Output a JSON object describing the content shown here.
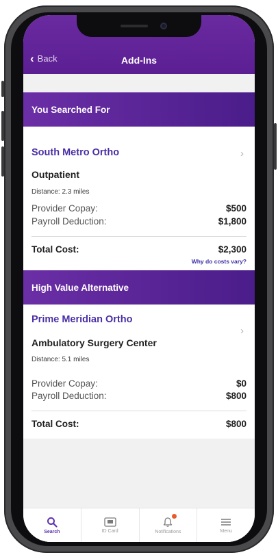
{
  "header": {
    "back_label": "Back",
    "title": "Add-Ins"
  },
  "searched": {
    "section_title": "You Searched For",
    "provider_name": "South Metro Ortho",
    "facility_type": "Outpatient",
    "distance": "Distance: 2.3 miles",
    "copay_label": "Provider Copay:",
    "copay_value": "$500",
    "payroll_label": "Payroll Deduction:",
    "payroll_value": "$1,800",
    "total_label": "Total Cost:",
    "total_value": "$2,300",
    "why_link": "Why do costs vary?"
  },
  "alternative": {
    "section_title": "High Value Alternative",
    "provider_name": "Prime Meridian Ortho",
    "facility_type": "Ambulatory Surgery Center",
    "distance": "Distance: 5.1 miles",
    "copay_label": "Provider Copay:",
    "copay_value": "$0",
    "payroll_label": "Payroll Deduction:",
    "payroll_value": "$800",
    "total_label": "Total Cost:",
    "total_value": "$800"
  },
  "tabbar": {
    "tabs": [
      {
        "label": "Search",
        "icon": "search-icon",
        "active": true
      },
      {
        "label": "ID Card",
        "icon": "id-card-icon",
        "active": false
      },
      {
        "label": "Notifications",
        "icon": "bell-icon",
        "active": false
      },
      {
        "label": "Menu",
        "icon": "menu-icon",
        "active": false
      }
    ]
  },
  "colors": {
    "brand_purple": "#5c1f93",
    "link_purple": "#4a2fa6",
    "notification_dot": "#e85a2c"
  }
}
